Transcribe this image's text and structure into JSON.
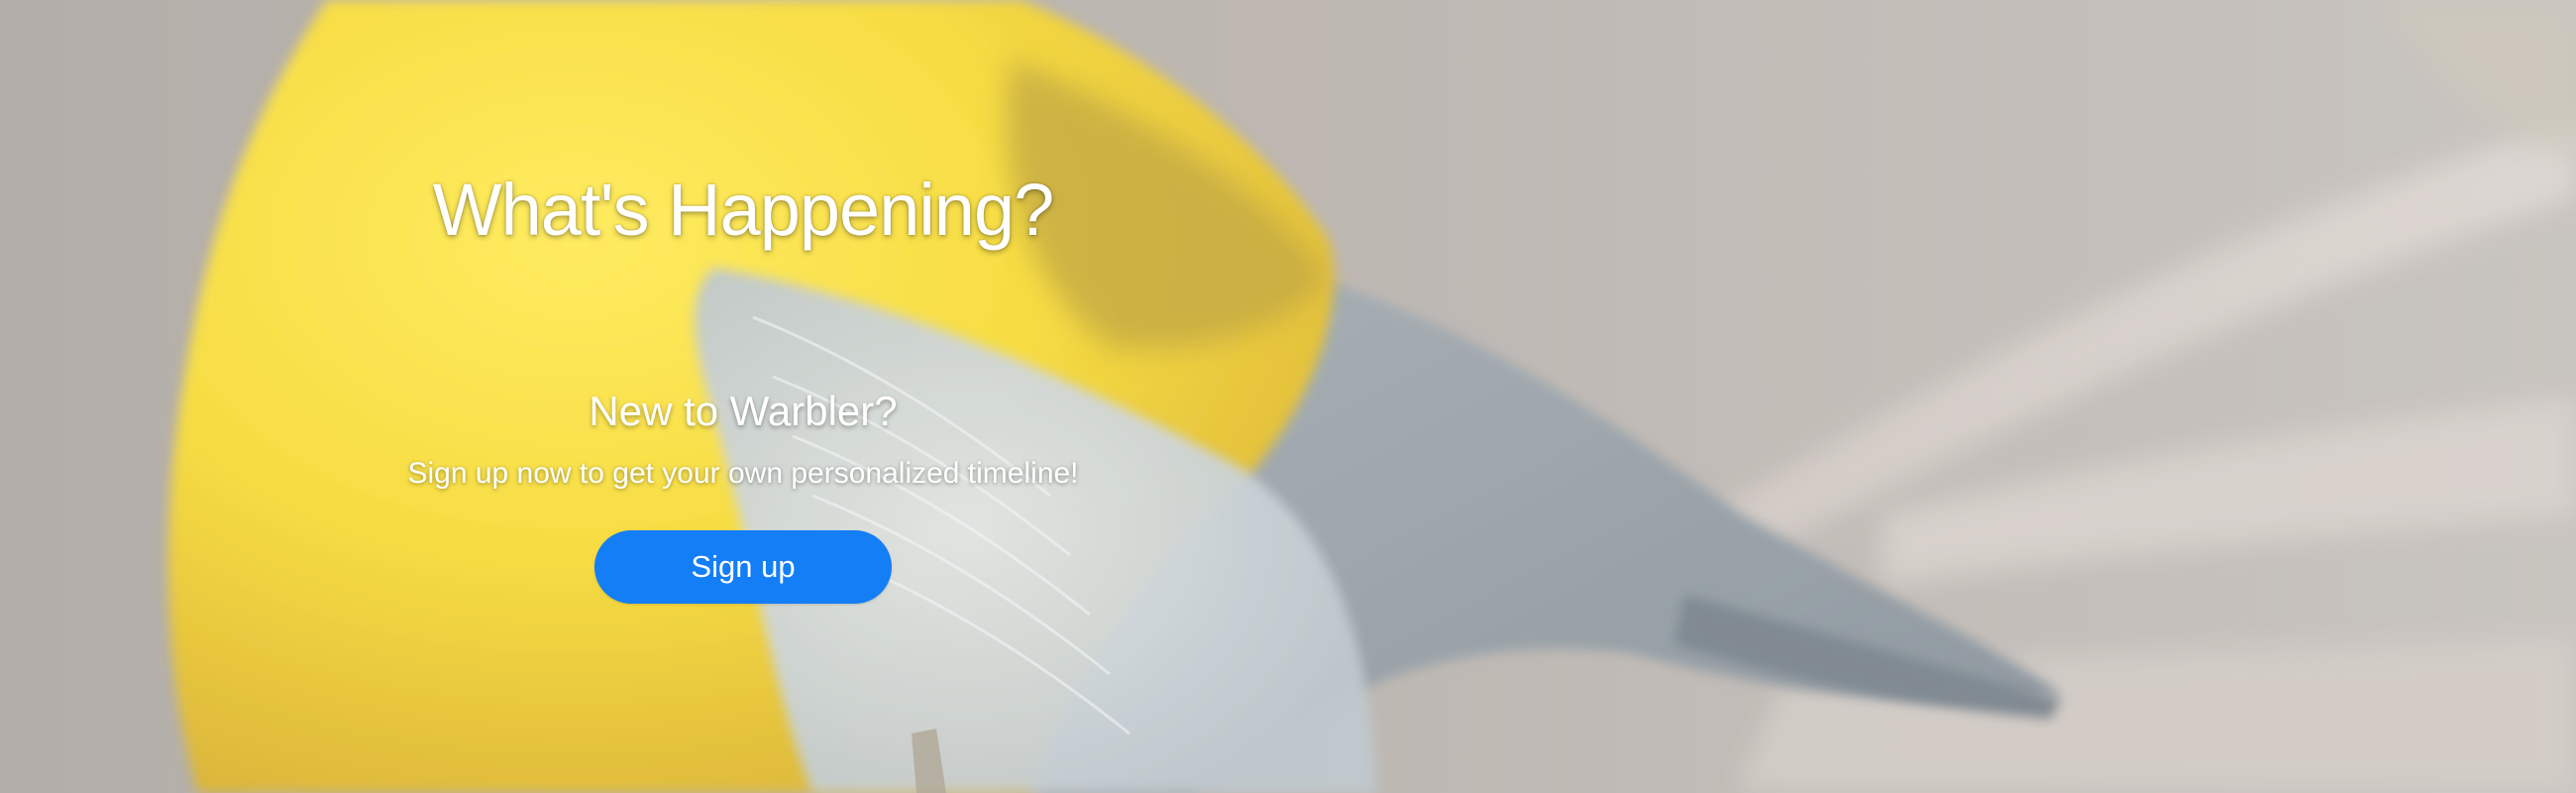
{
  "hero": {
    "headline": "What's Happening?",
    "background": "yellow-warbler-photo"
  },
  "signup": {
    "subhead": "New to Warbler?",
    "tagline": "Sign up now to get your own personalized timeline!",
    "button_label": "Sign up"
  },
  "colors": {
    "accent": "#147ef7",
    "text": "#ffffff"
  }
}
